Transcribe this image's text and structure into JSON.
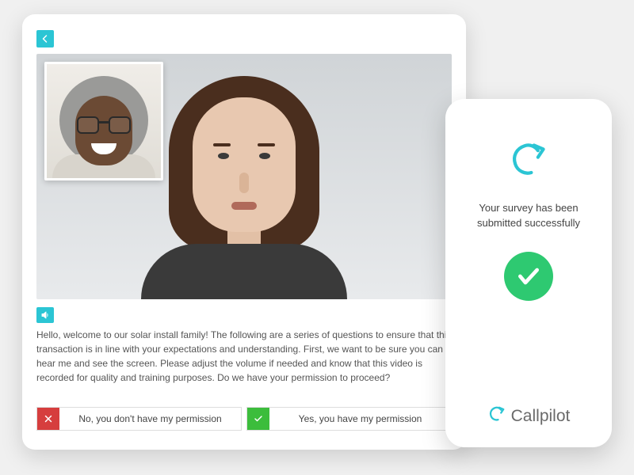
{
  "tablet": {
    "back_label": "Back",
    "speak_label": "Replay audio",
    "transcript": "Hello, welcome to our solar install family! The following are a series of questions to ensure that this transaction is in line with your expectations and understanding. First, we want to be sure you can hear me and see the screen. Please adjust the volume if needed and know that this video is recorded for quality and training purposes. Do we have your permission to proceed?",
    "answers": {
      "no": "No, you don't have my permission",
      "yes": "Yes, you have my permission"
    },
    "pip_label": "Customer video",
    "main_label": "Agent video"
  },
  "phone": {
    "confirm": "Your survey has been submitted successfully",
    "brand": "Callpilot",
    "status": "success"
  },
  "colors": {
    "accent": "#2bc5d4",
    "success": "#2ec971",
    "danger": "#d63e3e",
    "confirm": "#3cbd3c"
  }
}
